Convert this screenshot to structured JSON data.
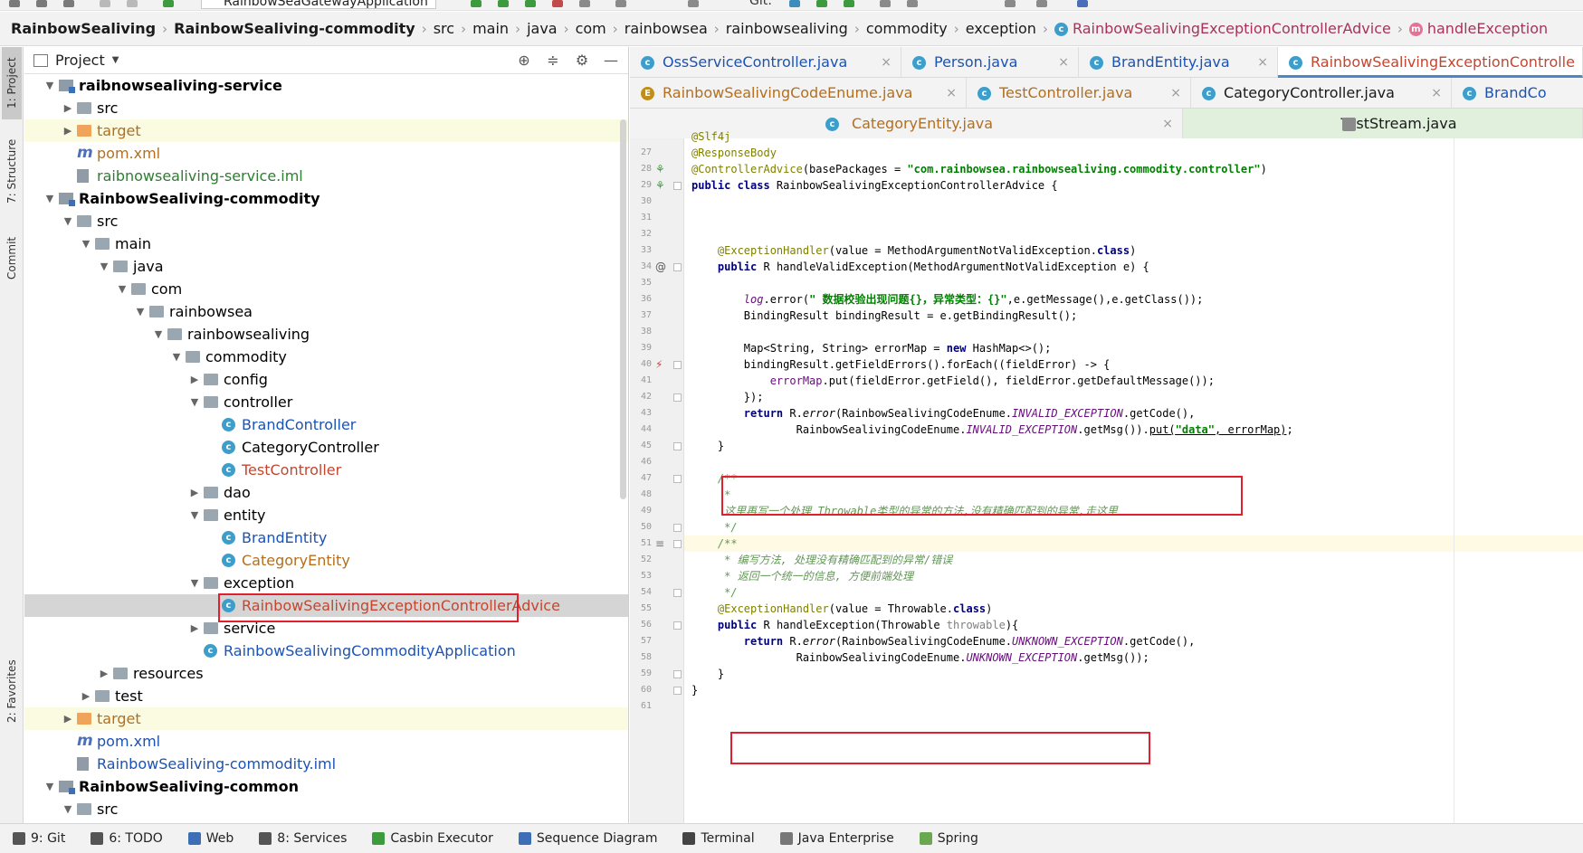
{
  "toolbar": {
    "run_config": "RainbowSeaGatewayApplication",
    "git_label": "Git:"
  },
  "breadcrumb": [
    "RainbowSealiving",
    "RainbowSealiving-commodity",
    "src",
    "main",
    "java",
    "com",
    "rainbowsea",
    "rainbowsealiving",
    "commodity",
    "exception",
    "RainbowSealivingExceptionControllerAdvice",
    "handleException"
  ],
  "left_strip": {
    "project": "1: Project",
    "structure": "7: Structure",
    "commit": "Commit",
    "favorites": "2: Favorites"
  },
  "project_panel": {
    "title": "Project",
    "tree": [
      {
        "label": "raibnowsealiving-service",
        "depth": 0,
        "type": "module",
        "expanded": true,
        "style": "bold"
      },
      {
        "label": "src",
        "depth": 1,
        "type": "folder",
        "expanded": false
      },
      {
        "label": "target",
        "depth": 1,
        "type": "folder-orange",
        "expanded": false,
        "style": "orange",
        "highlight": "yellow"
      },
      {
        "label": "pom.xml",
        "depth": 1,
        "type": "mfile",
        "style": "orange"
      },
      {
        "label": "raibnowsealiving-service.iml",
        "depth": 1,
        "type": "iml",
        "style": "green"
      },
      {
        "label": "RainbowSealiving-commodity",
        "depth": 0,
        "type": "module",
        "expanded": true,
        "style": "bold"
      },
      {
        "label": "src",
        "depth": 1,
        "type": "folder",
        "expanded": true
      },
      {
        "label": "main",
        "depth": 2,
        "type": "folder",
        "expanded": true
      },
      {
        "label": "java",
        "depth": 3,
        "type": "folder",
        "expanded": true
      },
      {
        "label": "com",
        "depth": 4,
        "type": "folder",
        "expanded": true
      },
      {
        "label": "rainbowsea",
        "depth": 5,
        "type": "folder",
        "expanded": true
      },
      {
        "label": "rainbowsealiving",
        "depth": 6,
        "type": "folder",
        "expanded": true
      },
      {
        "label": "commodity",
        "depth": 7,
        "type": "folder",
        "expanded": true
      },
      {
        "label": "config",
        "depth": 8,
        "type": "folder",
        "expanded": false
      },
      {
        "label": "controller",
        "depth": 8,
        "type": "folder",
        "expanded": true
      },
      {
        "label": "BrandController",
        "depth": 9,
        "type": "class",
        "style": "blue"
      },
      {
        "label": "CategoryController",
        "depth": 9,
        "type": "class"
      },
      {
        "label": "TestController",
        "depth": 9,
        "type": "class",
        "style": "red"
      },
      {
        "label": "dao",
        "depth": 8,
        "type": "folder",
        "expanded": false
      },
      {
        "label": "entity",
        "depth": 8,
        "type": "folder",
        "expanded": true
      },
      {
        "label": "BrandEntity",
        "depth": 9,
        "type": "class",
        "style": "blue"
      },
      {
        "label": "CategoryEntity",
        "depth": 9,
        "type": "class",
        "style": "orange"
      },
      {
        "label": "exception",
        "depth": 8,
        "type": "folder",
        "expanded": true
      },
      {
        "label": "RainbowSealivingExceptionControllerAdvice",
        "depth": 9,
        "type": "class",
        "style": "red",
        "highlight": "selected",
        "boxed": true
      },
      {
        "label": "service",
        "depth": 8,
        "type": "folder",
        "expanded": false
      },
      {
        "label": "RainbowSealivingCommodityApplication",
        "depth": 8,
        "type": "class",
        "style": "blue"
      },
      {
        "label": "resources",
        "depth": 3,
        "type": "folder",
        "expanded": false
      },
      {
        "label": "test",
        "depth": 2,
        "type": "folder",
        "expanded": false
      },
      {
        "label": "target",
        "depth": 1,
        "type": "folder-orange",
        "expanded": false,
        "style": "orange",
        "highlight": "yellow"
      },
      {
        "label": "pom.xml",
        "depth": 1,
        "type": "mfile",
        "style": "blue"
      },
      {
        "label": "RainbowSealiving-commodity.iml",
        "depth": 1,
        "type": "iml",
        "style": "blue"
      },
      {
        "label": "RainbowSealiving-common",
        "depth": 0,
        "type": "module",
        "expanded": true,
        "style": "bold"
      },
      {
        "label": "src",
        "depth": 1,
        "type": "folder",
        "expanded": true
      }
    ]
  },
  "editor_tabs": {
    "row1": [
      "OssServiceController.java",
      "Person.java",
      "BrandEntity.java",
      "RainbowSealivingExceptionControlle"
    ],
    "row2": [
      "RainbowSealivingCodeEnume.java",
      "TestController.java",
      "CategoryController.java",
      "BrandCo"
    ],
    "row3": [
      "CategoryEntity.java",
      "TestStream.java"
    ],
    "close_glyph": "×"
  },
  "code": {
    "lines": [
      {
        "n": "",
        "html": "<span class=\"an\">@Slf4j</span>"
      },
      {
        "n": "27",
        "html": "<span class=\"an\">@ResponseBody</span>"
      },
      {
        "n": "28",
        "html": "<span class=\"an\">@ControllerAdvice</span>(basePackages = <span class=\"str\">\"com.rainbowsea.rainbowsealiving.commodity.controller\"</span>)"
      },
      {
        "n": "29",
        "html": "<span class=\"k\">public class</span> RainbowSealivingExceptionControllerAdvice {"
      },
      {
        "n": "30",
        "html": ""
      },
      {
        "n": "31",
        "html": ""
      },
      {
        "n": "32",
        "html": ""
      },
      {
        "n": "33",
        "html": "    <span class=\"an\">@ExceptionHandler</span>(value = MethodArgumentNotValidException.<span class=\"k\">class</span>)"
      },
      {
        "n": "34",
        "html": "    <span class=\"k\">public</span> R handleValidException(MethodArgumentNotValidException e) {"
      },
      {
        "n": "35",
        "html": ""
      },
      {
        "n": "36",
        "html": "        <span class=\"fld\">log</span>.error(<span class=\"str\">\" 数据校验出现问题{}，异常类型：{}\"</span>,e.getMessage(),e.getClass());"
      },
      {
        "n": "37",
        "html": "        BindingResult bindingResult = e.getBindingResult();"
      },
      {
        "n": "38",
        "html": ""
      },
      {
        "n": "39",
        "html": "        Map&lt;String, String&gt; errorMap = <span class=\"k\">new</span> HashMap&lt;&gt;();"
      },
      {
        "n": "40",
        "html": "        bindingResult.getFieldErrors().forEach((fieldError) -&gt; {"
      },
      {
        "n": "41",
        "html": "            <span class=\"lv\">errorMap</span>.put(fieldError.getField(), fieldError.getDefaultMessage());"
      },
      {
        "n": "42",
        "html": "        });"
      },
      {
        "n": "43",
        "html": "        <span class=\"k\">return</span> R.<span class=\"it\">error</span>(RainbowSealivingCodeEnume.<span class=\"fld\">INVALID_EXCEPTION</span>.getCode(),"
      },
      {
        "n": "44",
        "html": "                RainbowSealivingCodeEnume.<span class=\"fld\">INVALID_EXCEPTION</span>.getMsg()).<span class=\"under\">put(<span class=\"str\">\"data\"</span>, errorMap)</span>;"
      },
      {
        "n": "45",
        "html": "    }"
      },
      {
        "n": "46",
        "html": ""
      },
      {
        "n": "47",
        "html": "    <span class=\"cm-doc\">/**</span>"
      },
      {
        "n": "48",
        "html": "     <span class=\"cm-doc\">*</span>"
      },
      {
        "n": "49",
        "html": "     <span class=\"cm-doc\">这里再写一个处理 Throwable类型的异常的方法,没有精确匹配到的异常,走这里</span>"
      },
      {
        "n": "50",
        "html": "     <span class=\"cm-doc\">*/</span>"
      },
      {
        "n": "51",
        "html": "    <span class=\"cm-doc\">/**</span>"
      },
      {
        "n": "52",
        "html": "     <span class=\"cm-doc\">* 编写方法, 处理没有精确匹配到的异常/错误</span>"
      },
      {
        "n": "53",
        "html": "     <span class=\"cm-doc\">* 返回一个统一的信息, 方便前端处理</span>"
      },
      {
        "n": "54",
        "html": "     <span class=\"cm-doc\">*/</span>"
      },
      {
        "n": "55",
        "html": "    <span class=\"an\">@ExceptionHandler</span>(value = Throwable.<span class=\"k\">class</span>)"
      },
      {
        "n": "56",
        "html": "    <span class=\"k\">public</span> R handleException(Throwable <span class=\"gray\">throwable</span>){"
      },
      {
        "n": "57",
        "html": "        <span class=\"k\">return</span> R.<span class=\"it\">error</span>(RainbowSealivingCodeEnume.<span class=\"fld\">UNKNOWN_EXCEPTION</span>.getCode(),"
      },
      {
        "n": "58",
        "html": "                RainbowSealivingCodeEnume.<span class=\"fld\">UNKNOWN_EXCEPTION</span>.getMsg());"
      },
      {
        "n": "59",
        "html": "    }"
      },
      {
        "n": "60",
        "html": "}"
      },
      {
        "n": "61",
        "html": ""
      }
    ]
  },
  "bottom_bar": [
    {
      "label": "9: Git",
      "key": "9",
      "icon": "git-icon"
    },
    {
      "label": "6: TODO",
      "key": "6",
      "icon": "todo-icon"
    },
    {
      "label": "Web",
      "icon": "web-icon"
    },
    {
      "label": "8: Services",
      "key": "8",
      "icon": "services-icon"
    },
    {
      "label": "Casbin Executor",
      "icon": "casbin-icon"
    },
    {
      "label": "Sequence Diagram",
      "icon": "sequence-diagram-icon"
    },
    {
      "label": "Terminal",
      "icon": "terminal-icon"
    },
    {
      "label": "Java Enterprise",
      "icon": "java-enterprise-icon"
    },
    {
      "label": "Spring",
      "icon": "spring-icon"
    }
  ],
  "colors": {
    "highlight_box": "#e0202c",
    "selected_row": "#d5d5d5",
    "excluded_row": "#fbfbe1",
    "active_tab_underline": "#4a88c7"
  }
}
